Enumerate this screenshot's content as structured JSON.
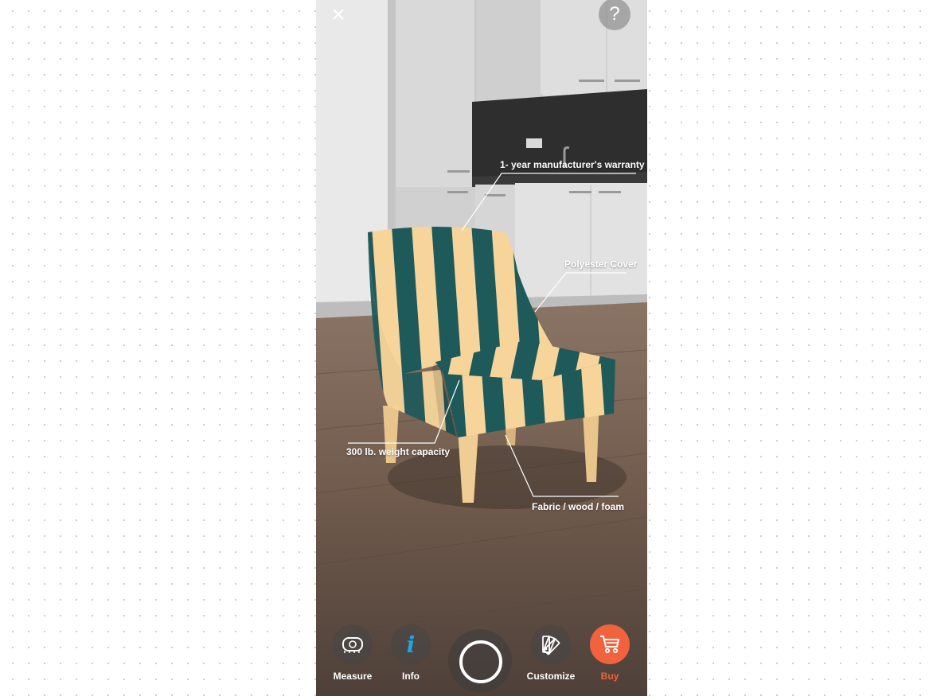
{
  "top_bar": {
    "close_icon": "close-x-icon",
    "help_label": "?"
  },
  "callouts": [
    {
      "label": "1- year manufacturer's warranty"
    },
    {
      "label": "Polyester Cover"
    },
    {
      "label": "300 lb. weight capacity"
    },
    {
      "label": "Fabric / wood / foam"
    }
  ],
  "toolbar": {
    "measure": {
      "label": "Measure",
      "icon": "tape-measure-icon"
    },
    "info": {
      "label": "Info",
      "icon": "info-icon",
      "glyph": "i"
    },
    "capture": {
      "icon": "shutter-icon"
    },
    "customize": {
      "label": "Customize",
      "icon": "swatch-fan-icon"
    },
    "buy": {
      "label": "Buy",
      "icon": "cart-icon"
    }
  },
  "colors": {
    "accent_buy": "#f2623d",
    "info_blue": "#1aa7e8",
    "stripe_teal": "#1f5a5a",
    "stripe_cream": "#f6d49a"
  }
}
